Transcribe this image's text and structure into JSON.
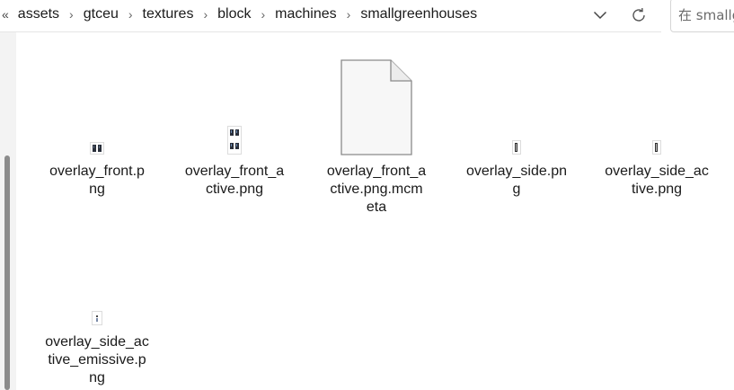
{
  "breadcrumb": {
    "more_glyph": "«",
    "items": [
      "assets",
      "gtceu",
      "textures",
      "block",
      "machines",
      "smallgreenhouses"
    ],
    "separator": "›"
  },
  "search": {
    "placeholder": "在 smallg"
  },
  "icons": {
    "history_dropdown": "chevron-down-icon",
    "refresh": "refresh-icon"
  },
  "files": [
    {
      "name_lines": [
        "overlay_front.p",
        "ng"
      ],
      "thumb": "double-block-thumbnail"
    },
    {
      "name_lines": [
        "overlay_front_a",
        "ctive.png"
      ],
      "thumb": "quad-block-thumbnail"
    },
    {
      "name_lines": [
        "overlay_front_a",
        "ctive.png.mcm",
        "eta"
      ],
      "thumb": "blank-file-icon"
    },
    {
      "name_lines": [
        "overlay_side.pn",
        "g"
      ],
      "thumb": "thin-bar-thumbnail"
    },
    {
      "name_lines": [
        "overlay_side_ac",
        "tive.png"
      ],
      "thumb": "thin-bar-thumbnail"
    },
    {
      "name_lines": [
        "overlay_side_ac",
        "tive_emissive.p",
        "ng"
      ],
      "thumb": "tiny-mark-thumbnail"
    }
  ]
}
